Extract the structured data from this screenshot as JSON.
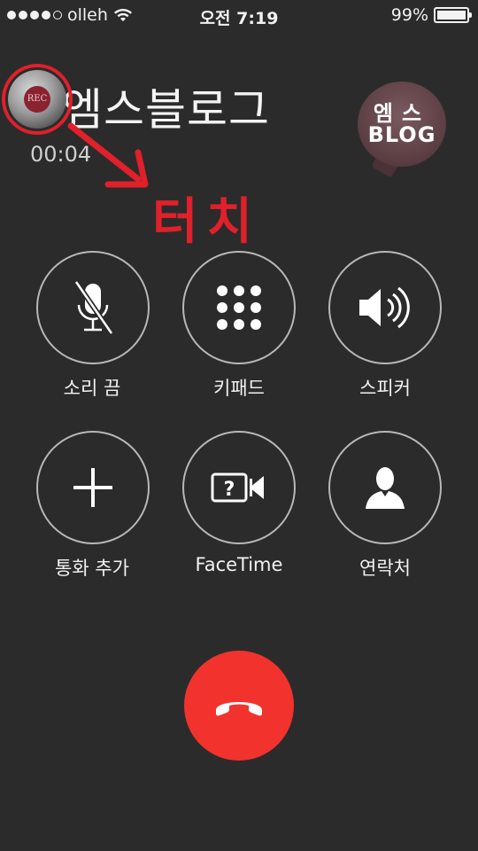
{
  "status_bar": {
    "carrier": "olleh",
    "time": "오전 7:19",
    "battery_percent": "99%",
    "battery_level": 0.99
  },
  "call": {
    "caller_name": "엠스블로그",
    "duration": "00:04"
  },
  "overlay": {
    "rec_label": "REC",
    "touch_label": "터치",
    "accent_color": "#e0202a"
  },
  "blog_badge": {
    "line1": "엠스",
    "line2": "BLOG"
  },
  "buttons": [
    {
      "label": "소리 끔",
      "icon": "mute-mic-icon"
    },
    {
      "label": "키패드",
      "icon": "keypad-icon"
    },
    {
      "label": "스피커",
      "icon": "speaker-icon"
    },
    {
      "label": "통화 추가",
      "icon": "plus-icon"
    },
    {
      "label": "FaceTime",
      "icon": "facetime-icon"
    },
    {
      "label": "연락처",
      "icon": "contact-icon"
    }
  ],
  "end_call": {
    "icon": "hangup-icon",
    "color": "#f2322d"
  }
}
